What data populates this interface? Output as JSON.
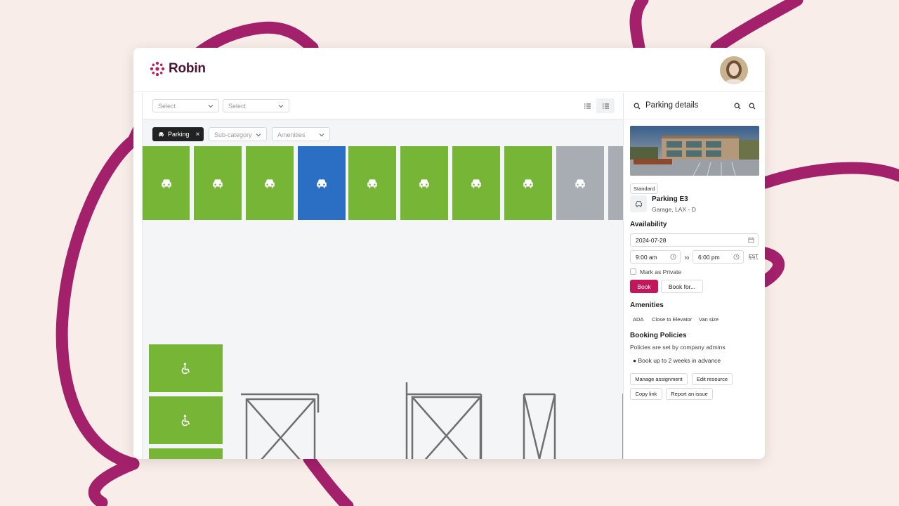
{
  "colors": {
    "accent": "#c2185b",
    "brand": "#4a1433",
    "spot_available": "#76b536",
    "spot_selected": "#2a6fc3",
    "spot_unavailable": "#a7adb3",
    "background_curve": "#a3206b"
  },
  "app": {
    "logo_text": "Robin",
    "logo_icon": "dot-cluster-icon",
    "user_avatar": "avatar"
  },
  "filters": {
    "select_1": {
      "label": "Select"
    },
    "select_2": {
      "label": "Select"
    },
    "view_toggle": [
      "list-icon",
      "list-detail-icon"
    ]
  },
  "chips": {
    "active": {
      "label": "Parking",
      "icon": "car-icon"
    },
    "subcategory": "Sub-category",
    "amenities": "Amenities"
  },
  "map": {
    "spots": [
      {
        "status": "available",
        "icon": "car-icon"
      },
      {
        "status": "available",
        "icon": "car-icon"
      },
      {
        "status": "available",
        "icon": "car-icon"
      },
      {
        "status": "selected",
        "icon": "car-icon"
      },
      {
        "status": "available",
        "icon": "car-icon"
      },
      {
        "status": "available",
        "icon": "car-icon"
      },
      {
        "status": "available",
        "icon": "car-icon"
      },
      {
        "status": "available",
        "icon": "car-icon"
      },
      {
        "status": "unavailable",
        "icon": "car-icon"
      },
      {
        "status": "unavailable",
        "icon": "car-icon"
      }
    ],
    "ada_spots": [
      {
        "status": "available",
        "icon": "wheelchair-icon"
      },
      {
        "status": "available",
        "icon": "wheelchair-icon"
      },
      {
        "status": "available",
        "icon": ""
      }
    ]
  },
  "panel": {
    "title": "Parking details",
    "tag": "Standard",
    "resource_name": "Parking E3",
    "resource_location": "Garage, LAX - D",
    "availability_heading": "Availability",
    "date": "2024-07-28",
    "start_time": "9:00 am",
    "to_label": "to",
    "end_time": "6:00 pm",
    "timezone": "EST",
    "private_label": "Mark as Private",
    "book_label": "Book",
    "book_for_label": "Book for...",
    "amenities_heading": "Amenities",
    "amenities": [
      "ADA",
      "Close to Elevator",
      "Van size"
    ],
    "policies_heading": "Booking Policies",
    "policies_text": "Policies are set by company admins",
    "policy_item": "Book up to 2 weeks in advance",
    "actions": [
      "Manage assignment",
      "Edit resource",
      "Copy link",
      "Report an issue"
    ]
  }
}
